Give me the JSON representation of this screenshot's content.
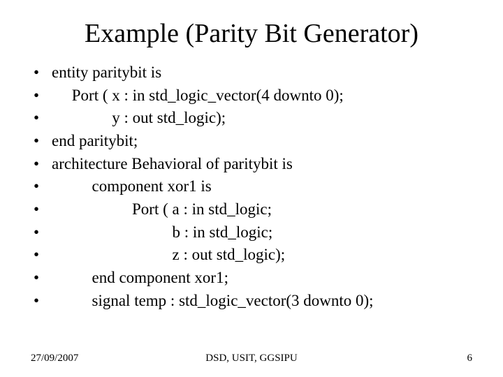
{
  "title": "Example (Parity Bit Generator)",
  "bullets": [
    "entity paritybit is",
    "     Port ( x : in std_logic_vector(4 downto 0);",
    "               y : out std_logic);",
    "end paritybit;",
    "architecture Behavioral of paritybit is",
    "          component xor1 is",
    "                    Port ( a : in std_logic;",
    "                              b : in std_logic;",
    "                              z : out std_logic);",
    "          end component xor1;",
    "          signal temp : std_logic_vector(3 downto 0);"
  ],
  "footer": {
    "date": "27/09/2007",
    "center": "DSD, USIT, GGSIPU",
    "page": "6"
  }
}
